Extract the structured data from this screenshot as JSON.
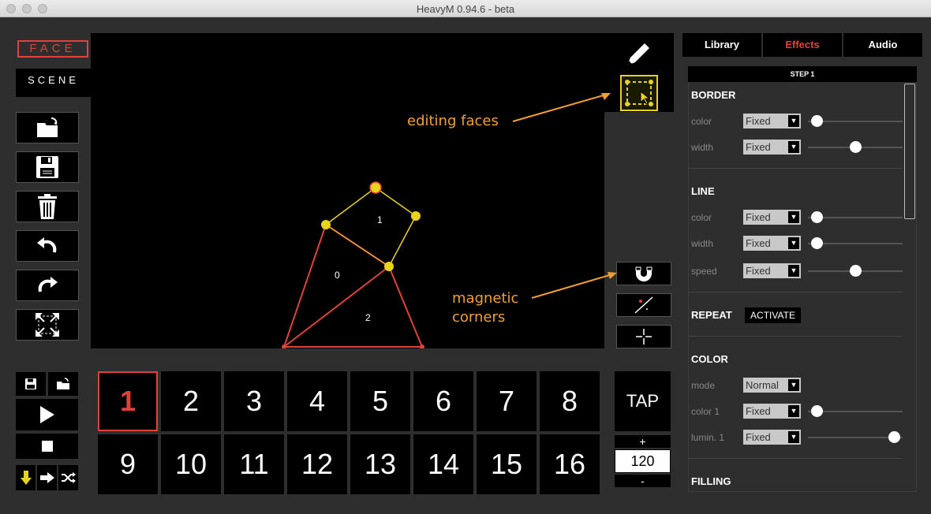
{
  "window": {
    "title": "HeavyM 0.94.6 - beta"
  },
  "modes": {
    "face": "FACE",
    "scene": "SCENE"
  },
  "annotations": {
    "editing": "editing faces",
    "magnetic_line1": "magnetic",
    "magnetic_line2": "corners"
  },
  "canvas": {
    "face_labels": [
      "0",
      "1",
      "2"
    ]
  },
  "sequencer": {
    "steps": [
      "1",
      "2",
      "3",
      "4",
      "5",
      "6",
      "7",
      "8",
      "9",
      "10",
      "11",
      "12",
      "13",
      "14",
      "15",
      "16"
    ],
    "active_step": "1"
  },
  "tempo": {
    "tap": "TAP",
    "plus": "+",
    "minus": "-",
    "bpm": "120"
  },
  "right_panel": {
    "tabs": [
      "Library",
      "Effects",
      "Audio"
    ],
    "selected_tab": "Effects",
    "step_title": "STEP 1",
    "sections": {
      "border": {
        "title": "BORDER",
        "color_label": "color",
        "color_mode": "Fixed",
        "color_level": 0.09,
        "width_label": "width",
        "width_mode": "Fixed",
        "width_level": 0.5
      },
      "line": {
        "title": "LINE",
        "color_label": "color",
        "color_mode": "Fixed",
        "color_level": 0.09,
        "width_label": "width",
        "width_mode": "Fixed",
        "width_level": 0.09,
        "speed_label": "speed",
        "speed_mode": "Fixed",
        "speed_level": 0.5
      },
      "repeat": {
        "title": "REPEAT",
        "button": "ACTIVATE"
      },
      "color": {
        "title": "COLOR",
        "mode_label": "mode",
        "mode_value": "Normal",
        "color1_label": "color 1",
        "color1_mode": "Fixed",
        "color1_level": 0.09,
        "lumin1_label": "lumin. 1",
        "lumin1_mode": "Fixed",
        "lumin1_level": 0.91
      },
      "filling": {
        "title": "FILLING"
      }
    }
  },
  "colors": {
    "accent_red": "#e0423a",
    "vertex_yellow": "#e8d41a",
    "annotation_orange": "#f0a030"
  }
}
